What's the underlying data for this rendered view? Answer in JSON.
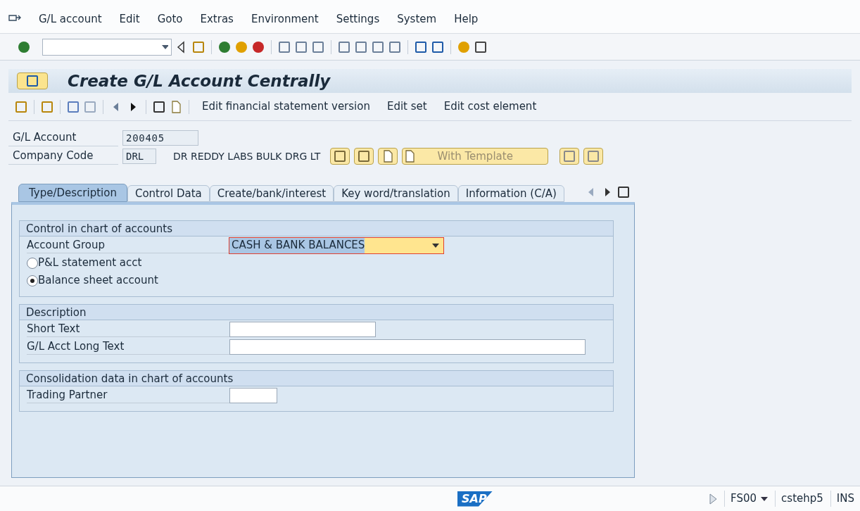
{
  "menu": [
    "G/L account",
    "Edit",
    "Goto",
    "Extras",
    "Environment",
    "Settings",
    "System",
    "Help"
  ],
  "title": "Create G/L Account Centrally",
  "app_toolbar": [
    "Edit financial statement version",
    "Edit set",
    "Edit cost element"
  ],
  "header_fields": [
    {
      "label": "G/L Account",
      "value": "200405"
    },
    {
      "label": "Company Code",
      "value": "DRL",
      "description": "DR REDDY LABS BULK DRG LT"
    }
  ],
  "template_button": "With Template",
  "tabs": [
    {
      "label": "Type/Description",
      "selected": true
    },
    {
      "label": "Control Data",
      "selected": false
    },
    {
      "label": "Create/bank/interest",
      "selected": false
    },
    {
      "label": "Key word/translation",
      "selected": false
    },
    {
      "label": "Information (C/A)",
      "selected": false
    }
  ],
  "groups": [
    {
      "title": "Control in chart of accounts",
      "rows": [
        {
          "kind": "dropdown",
          "label": "Account Group",
          "value": "CASH & BANK BALANCES",
          "focused": true
        },
        {
          "kind": "radio",
          "label": "P&L statement acct",
          "selected": false
        },
        {
          "kind": "radio",
          "label": "Balance sheet account",
          "selected": true
        }
      ]
    },
    {
      "title": "Description",
      "rows": [
        {
          "kind": "input",
          "label": "Short Text"
        },
        {
          "kind": "longinput",
          "label": "G/L Acct Long Text"
        }
      ]
    },
    {
      "title": "Consolidation data in chart of accounts",
      "rows": [
        {
          "kind": "shortinput",
          "label": "Trading Partner"
        }
      ]
    }
  ],
  "status_bar": {
    "logo": "SAP",
    "transaction": "FS00",
    "server": "cstehp5",
    "mode": "INS"
  }
}
